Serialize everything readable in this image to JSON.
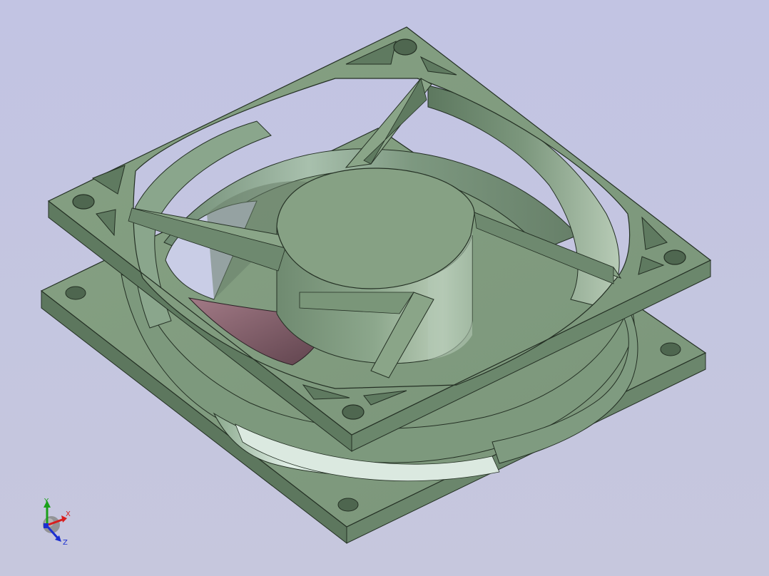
{
  "viewport": {
    "background": "#c2c4e3",
    "model": "fan-housing",
    "colors": {
      "body": "#7f9b7d",
      "body_dark": "#5f7a60",
      "body_light": "#a9c2a6",
      "edge": "#2a342a",
      "impeller": "#8e6c77"
    }
  },
  "triad": {
    "x_label": "X",
    "y_label": "Y",
    "z_label": "Z",
    "x_color": "#d81e1e",
    "y_color": "#1aa01a",
    "z_color": "#1c2fd0"
  }
}
